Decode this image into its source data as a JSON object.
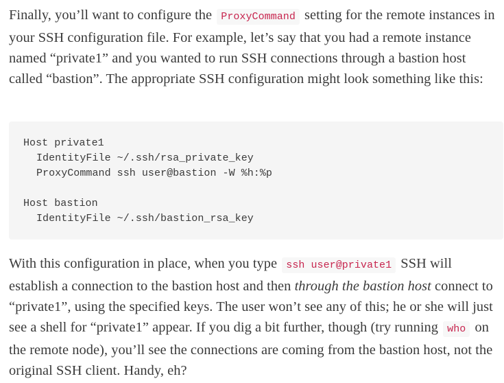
{
  "paragraph1": {
    "t1": "Finally, you’ll want to configure the ",
    "code1": "ProxyCommand",
    "t2": " setting for the remote instances in your SSH configuration file. For example, let’s say that you had a remote instance named “private1” and you wanted to run SSH connections through a bastion host called “bastion”. The appropriate SSH configuration might look something like this:"
  },
  "code_block": {
    "lines": [
      "Host private1",
      "IdentityFile ~/.ssh/rsa_private_key",
      "ProxyCommand ssh user@bastion -W %h:%p",
      "",
      "Host bastion",
      "IdentityFile ~/.ssh/bastion_rsa_key"
    ]
  },
  "paragraph2": {
    "t1": "With this configuration in place, when you type ",
    "code1": "ssh user@private1",
    "t2": " SSH will establish a connection to the bastion host and then ",
    "em1": "through the bastion host",
    "t3": " connect to “private1”, using the specified keys. The user won’t see any of this; he or she will just see a shell for “private1” appear. If you dig a bit further, though (try running ",
    "code2": "who",
    "t4": " on the remote node), you’ll see the connections are coming from the bastion host, not the original SSH client. Handy, eh?"
  }
}
